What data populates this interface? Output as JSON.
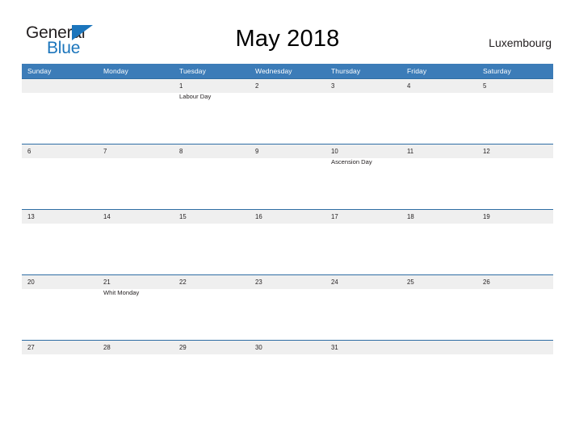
{
  "brand": {
    "name_part1": "General",
    "name_part2": "Blue",
    "triangle_icon": "blue-triangle-logo-mark",
    "color_primary": "#1b75bc",
    "color_text": "#231f20"
  },
  "header": {
    "title": "May 2018",
    "locale": "Luxembourg"
  },
  "theme": {
    "header_bar": "#3c7cb8",
    "row_divider": "#2e6da4",
    "week_band": "#efefef",
    "page_background": "#ffffff"
  },
  "calendar": {
    "month": "May",
    "year": "2018",
    "weekday_headers": [
      "Sunday",
      "Monday",
      "Tuesday",
      "Wednesday",
      "Thursday",
      "Friday",
      "Saturday"
    ],
    "weeks": [
      [
        {
          "day": "",
          "event": ""
        },
        {
          "day": "",
          "event": ""
        },
        {
          "day": "1",
          "event": "Labour Day"
        },
        {
          "day": "2",
          "event": ""
        },
        {
          "day": "3",
          "event": ""
        },
        {
          "day": "4",
          "event": ""
        },
        {
          "day": "5",
          "event": ""
        }
      ],
      [
        {
          "day": "6",
          "event": ""
        },
        {
          "day": "7",
          "event": ""
        },
        {
          "day": "8",
          "event": ""
        },
        {
          "day": "9",
          "event": ""
        },
        {
          "day": "10",
          "event": "Ascension Day"
        },
        {
          "day": "11",
          "event": ""
        },
        {
          "day": "12",
          "event": ""
        }
      ],
      [
        {
          "day": "13",
          "event": ""
        },
        {
          "day": "14",
          "event": ""
        },
        {
          "day": "15",
          "event": ""
        },
        {
          "day": "16",
          "event": ""
        },
        {
          "day": "17",
          "event": ""
        },
        {
          "day": "18",
          "event": ""
        },
        {
          "day": "19",
          "event": ""
        }
      ],
      [
        {
          "day": "20",
          "event": ""
        },
        {
          "day": "21",
          "event": "Whit Monday"
        },
        {
          "day": "22",
          "event": ""
        },
        {
          "day": "23",
          "event": ""
        },
        {
          "day": "24",
          "event": ""
        },
        {
          "day": "25",
          "event": ""
        },
        {
          "day": "26",
          "event": ""
        }
      ],
      [
        {
          "day": "27",
          "event": ""
        },
        {
          "day": "28",
          "event": ""
        },
        {
          "day": "29",
          "event": ""
        },
        {
          "day": "30",
          "event": ""
        },
        {
          "day": "31",
          "event": ""
        },
        {
          "day": "",
          "event": ""
        },
        {
          "day": "",
          "event": ""
        }
      ]
    ]
  }
}
